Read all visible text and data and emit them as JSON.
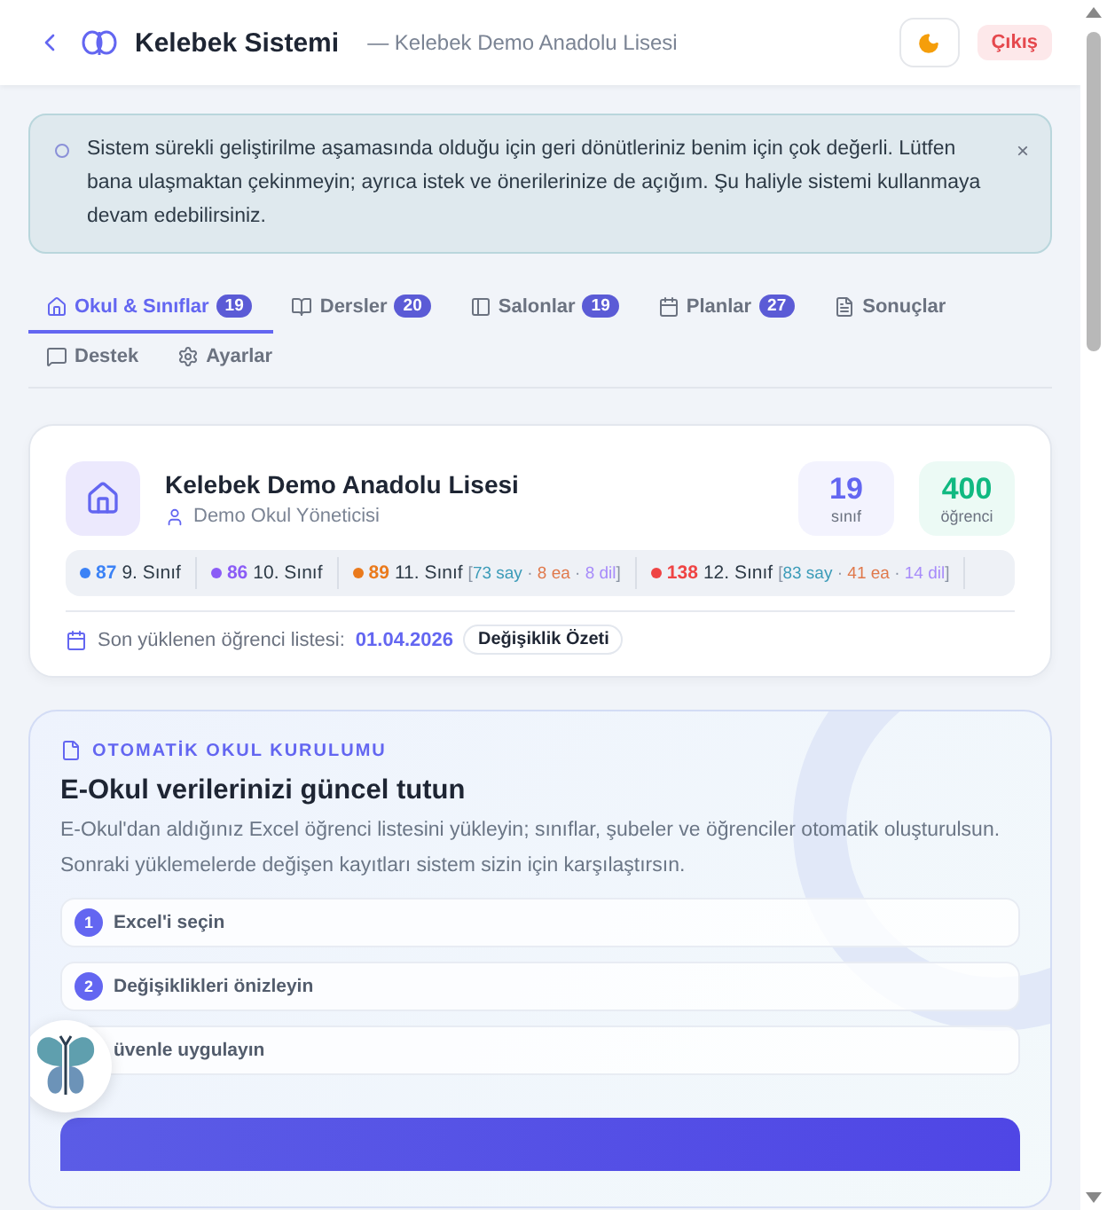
{
  "header": {
    "title": "Kelebek Sistemi",
    "subtitle": "— Kelebek Demo Anadolu Lisesi",
    "logout": "Çıkış"
  },
  "banner": {
    "text": "Sistem sürekli geliştirilme aşamasında olduğu için geri dönütleriniz benim için çok değerli. Lütfen bana ulaşmaktan çekinmeyin; ayrıca istek ve önerilerinize de açığım. Şu haliyle sistemi kullanmaya devam edebilirsiniz.",
    "close": "×"
  },
  "tabs": [
    {
      "label": "Okul & Sınıflar",
      "count": "19",
      "selected": true
    },
    {
      "label": "Dersler",
      "count": "20",
      "selected": false
    },
    {
      "label": "Salonlar",
      "count": "19",
      "selected": false
    },
    {
      "label": "Planlar",
      "count": "27",
      "selected": false
    },
    {
      "label": "Sonuçlar",
      "selected": false
    },
    {
      "label": "Destek",
      "selected": false
    },
    {
      "label": "Ayarlar",
      "selected": false
    }
  ],
  "school": {
    "name": "Kelebek Demo Anadolu Lisesi",
    "role": "Demo Okul Yöneticisi",
    "stats": [
      {
        "value": "19",
        "label": "sınıf",
        "color": "#6366f1"
      },
      {
        "value": "400",
        "label": "öğrenci",
        "color": "#10b981"
      }
    ],
    "grades": [
      {
        "count": "87",
        "label": "9. Sınıf",
        "color": "#3b82f6"
      },
      {
        "count": "86",
        "label": "10. Sınıf",
        "color": "#8b5cf6"
      },
      {
        "count": "89",
        "label": "11. Sınıf",
        "color": "#ea7a1c",
        "breakdown": {
          "open": "[",
          "separator": "·",
          "close": "]",
          "items": [
            {
              "text": "73 say",
              "color": "#3b9bb8"
            },
            {
              "text": "8 ea",
              "color": "#e0784a"
            },
            {
              "text": "8 dil",
              "color": "#a78bfa"
            }
          ]
        }
      },
      {
        "count": "138",
        "label": "12. Sınıf",
        "color": "#ef4444",
        "breakdown": {
          "open": "[",
          "separator": "·",
          "close": "]",
          "items": [
            {
              "text": "83 say",
              "color": "#3b9bb8"
            },
            {
              "text": "41 ea",
              "color": "#e0784a"
            },
            {
              "text": "14 dil",
              "color": "#a78bfa"
            }
          ]
        }
      }
    ],
    "last_upload_label": "Son yüklenen öğrenci listesi:",
    "last_upload_date": "01.04.2026",
    "changes_button": "Değişiklik Özeti"
  },
  "setup": {
    "eyebrow": "OTOMATİK OKUL KURULUMU",
    "title": "E-Okul verilerinizi güncel tutun",
    "description": "E-Okul'dan aldığınız Excel öğrenci listesini yükleyin; sınıflar, şubeler ve öğrenciler otomatik oluşturulsun. Sonraki yüklemelerde değişen kayıtları sistem sizin için karşılaştırsın.",
    "steps": [
      {
        "number": "1",
        "label": "Excel'i seçin"
      },
      {
        "number": "2",
        "label": "Değişiklikleri önizleyin"
      },
      {
        "label": "üvenle uygulayın"
      }
    ]
  }
}
